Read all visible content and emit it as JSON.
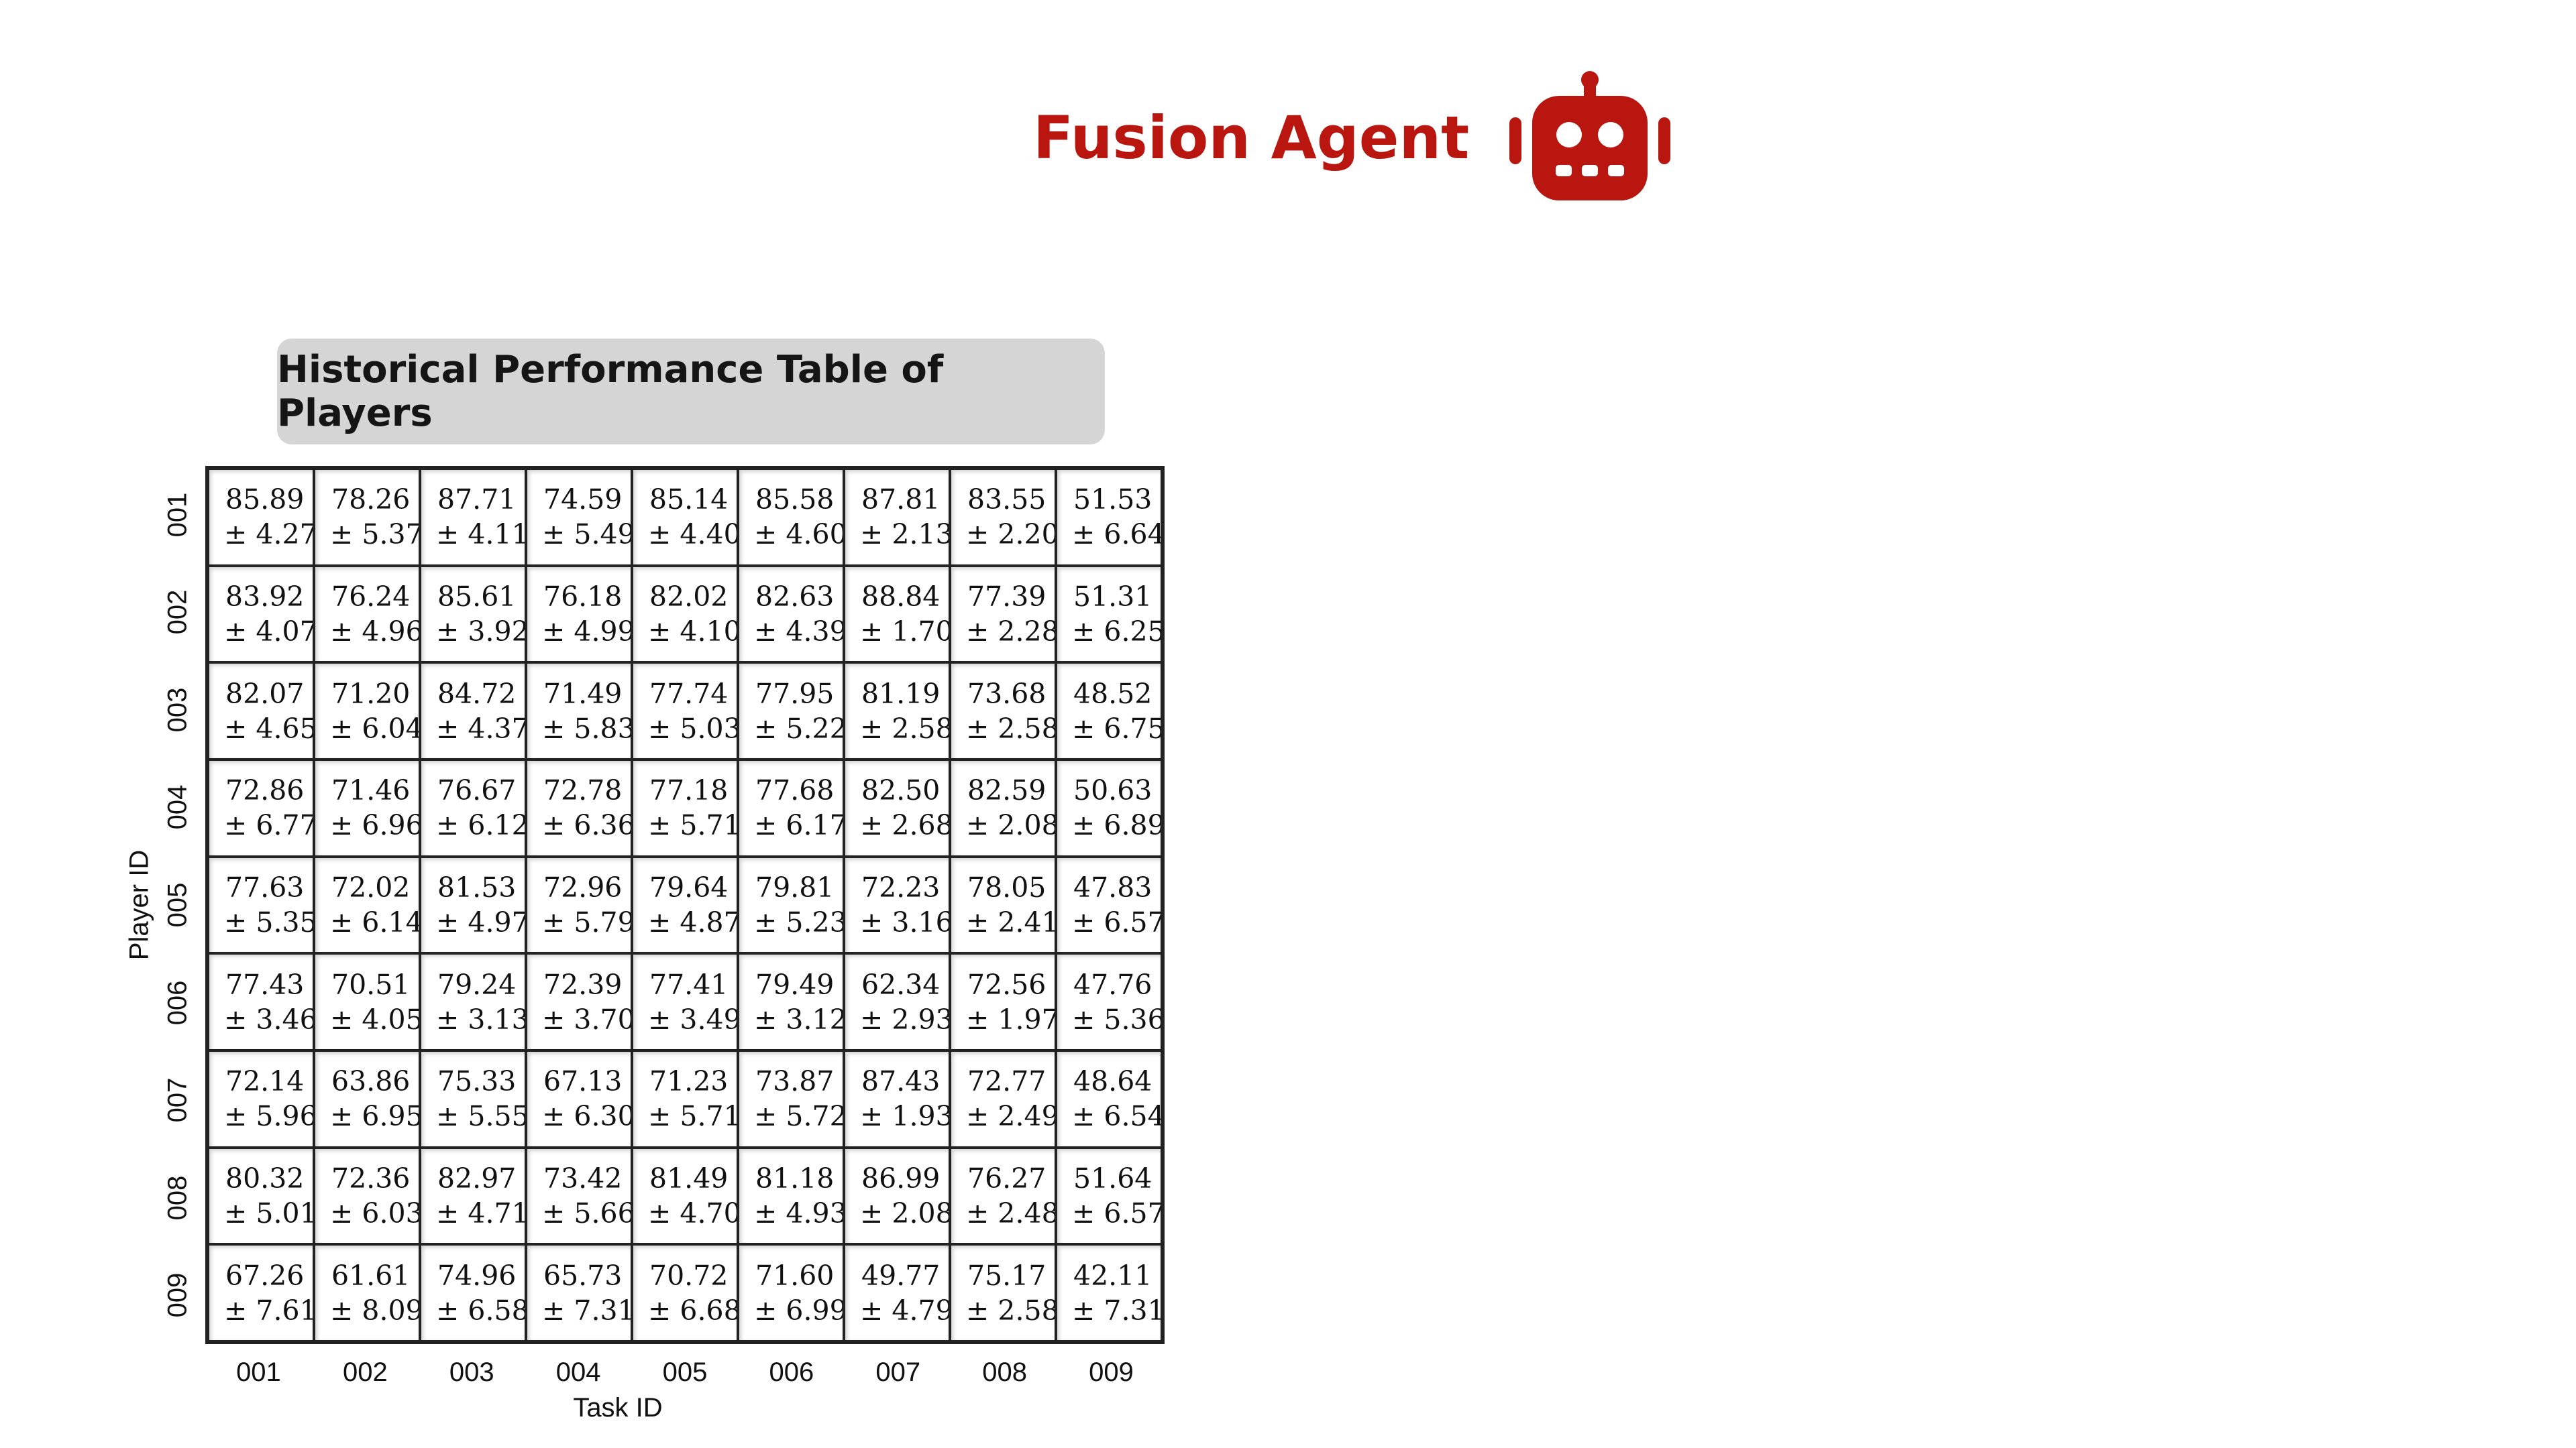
{
  "header": {
    "title": "Fusion Agent",
    "icon": "robot-icon",
    "accent_color": "#b8160f"
  },
  "table": {
    "title": "Historical Performance Table of Players",
    "x_axis_label": "Task ID",
    "y_axis_label": "Player ID",
    "task_ids": [
      "001",
      "002",
      "003",
      "004",
      "005",
      "006",
      "007",
      "008",
      "009"
    ],
    "player_ids": [
      "001",
      "002",
      "003",
      "004",
      "005",
      "006",
      "007",
      "008",
      "009"
    ],
    "rows": [
      [
        [
          "85.89",
          "± 4.27"
        ],
        [
          "78.26",
          "± 5.37"
        ],
        [
          "87.71",
          "± 4.11"
        ],
        [
          "74.59",
          "± 5.49"
        ],
        [
          "85.14",
          "± 4.40"
        ],
        [
          "85.58",
          "± 4.60"
        ],
        [
          "87.81",
          "± 2.13"
        ],
        [
          "83.55",
          "± 2.20"
        ],
        [
          "51.53",
          "± 6.64"
        ]
      ],
      [
        [
          "83.92",
          "± 4.07"
        ],
        [
          "76.24",
          "± 4.96"
        ],
        [
          "85.61",
          "± 3.92"
        ],
        [
          "76.18",
          "± 4.99"
        ],
        [
          "82.02",
          "± 4.10"
        ],
        [
          "82.63",
          "± 4.39"
        ],
        [
          "88.84",
          "± 1.70"
        ],
        [
          "77.39",
          "± 2.28"
        ],
        [
          "51.31",
          "± 6.25"
        ]
      ],
      [
        [
          "82.07",
          "± 4.65"
        ],
        [
          "71.20",
          "± 6.04"
        ],
        [
          "84.72",
          "± 4.37"
        ],
        [
          "71.49",
          "± 5.83"
        ],
        [
          "77.74",
          "± 5.03"
        ],
        [
          "77.95",
          "± 5.22"
        ],
        [
          "81.19",
          "± 2.58"
        ],
        [
          "73.68",
          "± 2.58"
        ],
        [
          "48.52",
          "± 6.75"
        ]
      ],
      [
        [
          "72.86",
          "± 6.77"
        ],
        [
          "71.46",
          "± 6.96"
        ],
        [
          "76.67",
          "± 6.12"
        ],
        [
          "72.78",
          "± 6.36"
        ],
        [
          "77.18",
          "± 5.71"
        ],
        [
          "77.68",
          "± 6.17"
        ],
        [
          "82.50",
          "± 2.68"
        ],
        [
          "82.59",
          "± 2.08"
        ],
        [
          "50.63",
          "± 6.89"
        ]
      ],
      [
        [
          "77.63",
          "± 5.35"
        ],
        [
          "72.02",
          "± 6.14"
        ],
        [
          "81.53",
          "± 4.97"
        ],
        [
          "72.96",
          "± 5.79"
        ],
        [
          "79.64",
          "± 4.87"
        ],
        [
          "79.81",
          "± 5.23"
        ],
        [
          "72.23",
          "± 3.16"
        ],
        [
          "78.05",
          "± 2.41"
        ],
        [
          "47.83",
          "± 6.57"
        ]
      ],
      [
        [
          "77.43",
          "± 3.46"
        ],
        [
          "70.51",
          "± 4.05"
        ],
        [
          "79.24",
          "± 3.13"
        ],
        [
          "72.39",
          "± 3.70"
        ],
        [
          "77.41",
          "± 3.49"
        ],
        [
          "79.49",
          "± 3.12"
        ],
        [
          "62.34",
          "± 2.93"
        ],
        [
          "72.56",
          "± 1.97"
        ],
        [
          "47.76",
          "± 5.36"
        ]
      ],
      [
        [
          "72.14",
          "± 5.96"
        ],
        [
          "63.86",
          "± 6.95"
        ],
        [
          "75.33",
          "± 5.55"
        ],
        [
          "67.13",
          "± 6.30"
        ],
        [
          "71.23",
          "± 5.71"
        ],
        [
          "73.87",
          "± 5.72"
        ],
        [
          "87.43",
          "± 1.93"
        ],
        [
          "72.77",
          "± 2.49"
        ],
        [
          "48.64",
          "± 6.54"
        ]
      ],
      [
        [
          "80.32",
          "± 5.01"
        ],
        [
          "72.36",
          "± 6.03"
        ],
        [
          "82.97",
          "± 4.71"
        ],
        [
          "73.42",
          "± 5.66"
        ],
        [
          "81.49",
          "± 4.70"
        ],
        [
          "81.18",
          "± 4.93"
        ],
        [
          "86.99",
          "± 2.08"
        ],
        [
          "76.27",
          "± 2.48"
        ],
        [
          "51.64",
          "± 6.57"
        ]
      ],
      [
        [
          "67.26",
          "± 7.61"
        ],
        [
          "61.61",
          "± 8.09"
        ],
        [
          "74.96",
          "± 6.58"
        ],
        [
          "65.73",
          "± 7.31"
        ],
        [
          "70.72",
          "± 6.68"
        ],
        [
          "71.60",
          "± 6.99"
        ],
        [
          "49.77",
          "± 4.79"
        ],
        [
          "75.17",
          "± 2.58"
        ],
        [
          "42.11",
          "± 7.31"
        ]
      ]
    ]
  }
}
